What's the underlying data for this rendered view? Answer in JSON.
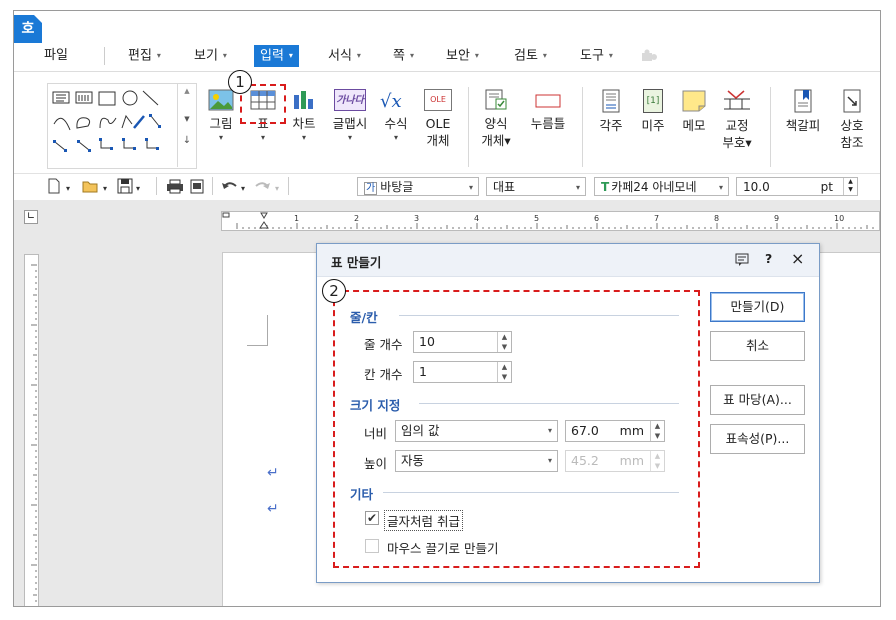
{
  "app": {
    "logo": "호"
  },
  "menu": [
    {
      "label": "파일",
      "arrow": ""
    },
    {
      "label": "편집",
      "arrow": "▾"
    },
    {
      "label": "보기",
      "arrow": "▾"
    },
    {
      "label": "입력",
      "arrow": "▾"
    },
    {
      "label": "서식",
      "arrow": "▾"
    },
    {
      "label": "쪽",
      "arrow": "▾"
    },
    {
      "label": "보안",
      "arrow": "▾"
    },
    {
      "label": "검토",
      "arrow": "▾"
    },
    {
      "label": "도구",
      "arrow": "▾"
    }
  ],
  "ribbon": {
    "picture": "그림",
    "table": "표",
    "chart": "차트",
    "fontart": "글맵시",
    "formula": "수식",
    "ole_1": "OLE",
    "ole_2": "개체",
    "ole_icon": "OLE",
    "form_1": "양식",
    "form_2": "개체▾",
    "pushbtn": "누름틀",
    "footnote": "각주",
    "endnote": "미주",
    "memo": "메모",
    "proof_1": "교정",
    "proof_2": "부호▾",
    "bookmark": "책갈피",
    "crossref_1": "상호",
    "crossref_2": "참조",
    "fontart_icon": "가나다",
    "endnote_icon": "[1]",
    "dropdown": "▾"
  },
  "toolbar": {
    "style": "바탕글",
    "style_icon": "가",
    "lang": "대표",
    "font": "카페24 아네모네",
    "font_icon": "T",
    "size": "10.0",
    "unit": "pt"
  },
  "ruler": {
    "marks": [
      "1",
      "2",
      "3",
      "4",
      "5",
      "6",
      "7",
      "8",
      "9",
      "10"
    ]
  },
  "document": {
    "para_mark": "↵"
  },
  "dialog": {
    "title": "표 만들기",
    "help": "?",
    "close": "×",
    "section_rowcol": "줄/칸",
    "rows_label": "줄 개수",
    "rows_value": "10",
    "cols_label": "칸 개수",
    "cols_value": "1",
    "section_size": "크기 지정",
    "width_label": "너비",
    "width_mode": "임의 값",
    "width_value": "67.0",
    "width_unit": "mm",
    "height_label": "높이",
    "height_mode": "자동",
    "height_value": "45.2",
    "height_unit": "mm",
    "section_etc": "기타",
    "treat_as_char": "글자처럼 취급",
    "treat_as_char_checked": true,
    "check_mark": "✔",
    "mouse_drag": "마우스 끌기로 만들기",
    "mouse_drag_checked": false,
    "btn_create": "만들기(D)",
    "btn_cancel": "취소",
    "btn_wizard": "표 마당(A)...",
    "btn_props": "표속성(P)..."
  },
  "callouts": {
    "one": "1",
    "two": "2"
  }
}
